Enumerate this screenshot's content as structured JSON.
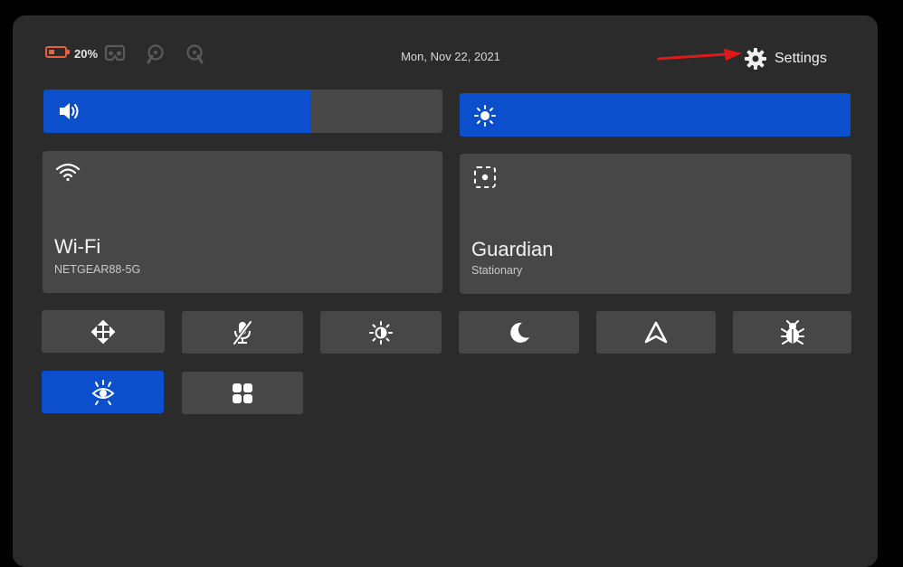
{
  "status_bar": {
    "battery_percent": "20%",
    "battery_color": "#e8613f",
    "date": "Mon, Nov 22, 2021",
    "settings_label": "Settings",
    "icons": [
      "battery-icon",
      "headset-icon",
      "controller-left-icon",
      "controller-right-icon",
      "gear-icon"
    ]
  },
  "sliders": {
    "volume": {
      "icon": "speaker-icon",
      "level": 0.67
    },
    "brightness": {
      "icon": "sun-icon",
      "level": 1.0
    }
  },
  "tiles": {
    "wifi": {
      "icon": "wifi-icon",
      "title": "Wi-Fi",
      "subtitle": "NETGEAR88-5G"
    },
    "guardian": {
      "icon": "guardian-boundary-icon",
      "title": "Guardian",
      "subtitle": "Stationary"
    }
  },
  "quick_buttons": [
    {
      "name": "move-icon",
      "active": false
    },
    {
      "name": "mic-muted-icon",
      "active": false
    },
    {
      "name": "brightness-contrast-icon",
      "active": false
    },
    {
      "name": "moon-icon",
      "active": false
    },
    {
      "name": "delta-icon",
      "active": false
    },
    {
      "name": "bug-icon",
      "active": false
    },
    {
      "name": "passthrough-eye-icon",
      "active": true
    },
    {
      "name": "app-grid-icon",
      "active": false
    }
  ],
  "colors": {
    "accent": "#0b4fcc",
    "tile": "#474747",
    "panel": "#2b2b2b",
    "annotation_arrow": "#e01a1a"
  }
}
